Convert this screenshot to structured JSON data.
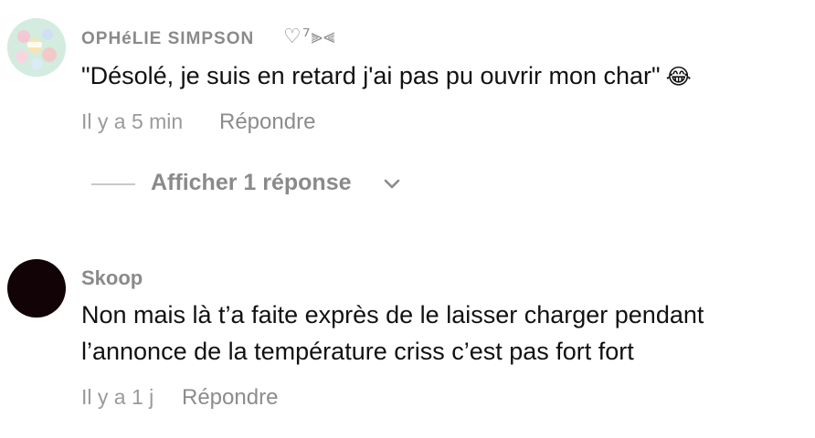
{
  "comments": [
    {
      "username": "OPHéLIE SIMPSON",
      "decoration": "♡⁷⫸⫷",
      "text": "\"Désolé, je suis en retard j'ai pas pu ouvrir mon char\"",
      "emoji": "😂",
      "time": "Il y a 5 min",
      "reply_label": "Répondre",
      "replies_label": "Afficher 1 réponse"
    },
    {
      "username": "Skoop",
      "text_line1": "Non mais là t’a faite exprès de le laisser charger pendant",
      "text_line2": "l’annonce de la température criss c’est pas fort fort",
      "time": "Il y a 1 j",
      "reply_label": "Répondre"
    }
  ],
  "icons": {
    "expand": "chevron-down-icon"
  }
}
